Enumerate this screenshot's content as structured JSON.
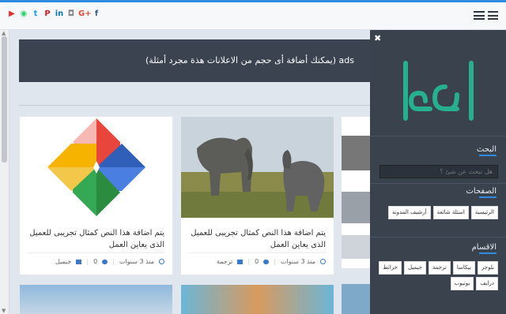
{
  "topbar": {
    "socials": [
      {
        "icon": "facebook-icon",
        "glyph": "f",
        "color": "#3b5998"
      },
      {
        "icon": "googleplus-icon",
        "glyph": "G+",
        "color": "#dd4b39"
      },
      {
        "icon": "instagram-icon",
        "glyph": "◘",
        "color": "#8a8a8a"
      },
      {
        "icon": "linkedin-icon",
        "glyph": "in",
        "color": "#0077b5"
      },
      {
        "icon": "pinterest-icon",
        "glyph": "P",
        "color": "#cb2027"
      },
      {
        "icon": "twitter-icon",
        "glyph": "t",
        "color": "#1da1f2"
      },
      {
        "icon": "whatsapp-icon",
        "glyph": "◉",
        "color": "#25d366"
      },
      {
        "icon": "youtube-icon",
        "glyph": "▶",
        "color": "#e52d27"
      }
    ]
  },
  "ads": {
    "text": "ads (يمكنك أضافة أى حجم من الاعلانات هذة مجرد أمثلة)"
  },
  "posts": [
    {
      "title": "يتم اضافة هذا النص كمثال تجريبى للعميل الذى يعاين العمل",
      "time": "منذ 3 سنوات",
      "comments": "0",
      "label": "ترجمة"
    },
    {
      "title": "يتم اضافة هذا النص كمثال تجريبى للعميل الذى يعاين العمل",
      "time": "منذ 3 سنوات",
      "comments": "0",
      "label": "جيميل"
    }
  ],
  "panel": {
    "close": "✖",
    "logo_text": "اوصال",
    "search_heading": "البحث",
    "search_placeholder": "هل تبحث عن شئ ؟",
    "pages_heading": "الصفحات",
    "pages": [
      "الرئيسية",
      "اسئلة شائعة",
      "أرشيف المدونة"
    ],
    "sections_heading": "الاقسام",
    "sections": [
      "بلوجر",
      "بيكاسا",
      "ترجمة",
      "جيميل",
      "خرائط",
      "درايف",
      "يوتيوب"
    ]
  },
  "colors": {
    "accent": "#2f8be0",
    "panel": "#3a424e",
    "logo": "#26b08f"
  }
}
